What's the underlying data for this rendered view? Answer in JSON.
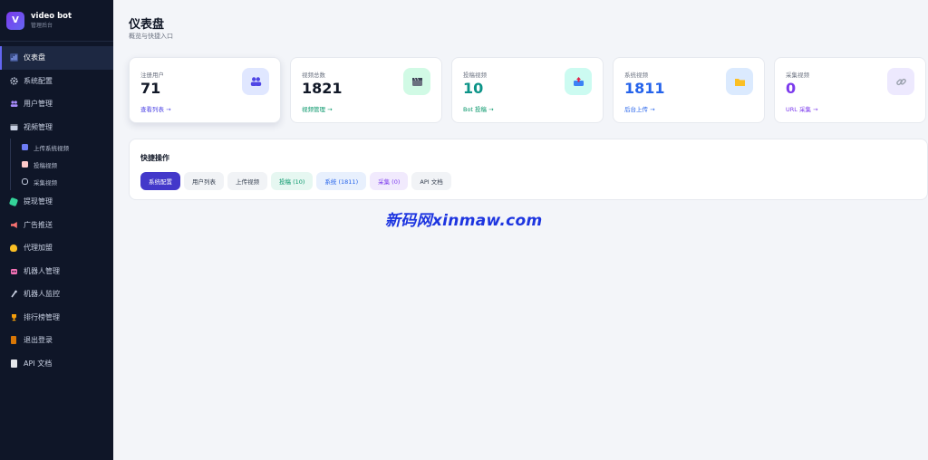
{
  "brand": {
    "logo_letter": "V",
    "title": "video bot",
    "subtitle": "管理后台"
  },
  "sidebar": {
    "items": [
      {
        "label": "仪表盘",
        "icon": "chart-icon",
        "color": "#8ea7ff",
        "active": true
      },
      {
        "label": "系统配置",
        "icon": "gear-icon",
        "color": "#c9d1e3"
      },
      {
        "label": "用户管理",
        "icon": "users-icon",
        "color": "#a78bfa"
      },
      {
        "label": "视频管理",
        "icon": "film-icon",
        "color": "#c9d1e3"
      }
    ],
    "sub_items": [
      {
        "label": "上传系统视频",
        "color": "#93a4ff"
      },
      {
        "label": "投稿视频",
        "color": "#fca5a5"
      },
      {
        "label": "采集视频",
        "color": "#c9d1e3"
      }
    ],
    "items_after": [
      {
        "label": "提现管理",
        "icon": "money-icon",
        "color": "#34d399"
      },
      {
        "label": "广告推送",
        "icon": "megaphone-icon",
        "color": "#f87171"
      },
      {
        "label": "代理加盟",
        "icon": "handshake-icon",
        "color": "#fbbf24"
      },
      {
        "label": "机器人管理",
        "icon": "robot-icon",
        "color": "#f472b6"
      },
      {
        "label": "机器人监控",
        "icon": "monitor-icon",
        "color": "#c9d1e3"
      },
      {
        "label": "排行榜管理",
        "icon": "trophy-icon",
        "color": "#f59e0b"
      },
      {
        "label": "退出登录",
        "icon": "door-icon",
        "color": "#d97706"
      },
      {
        "label": "API 文档",
        "icon": "document-icon",
        "color": "#e5e7eb"
      }
    ]
  },
  "header": {
    "title": "仪表盘",
    "subtitle": "概览与快捷入口"
  },
  "stats": [
    {
      "label": "注册用户",
      "value": "71",
      "link": "查看列表 →",
      "value_color": "#111827",
      "link_color": "#4f46e5",
      "icon": "users-icon",
      "icon_bg": "#e0e7ff",
      "icon_color": "#4f46e5"
    },
    {
      "label": "视频总数",
      "value": "1821",
      "link": "视频管理 →",
      "value_color": "#111827",
      "link_color": "#059669",
      "icon": "film-icon",
      "icon_bg": "#d1fae5",
      "icon_color": "#6b7280"
    },
    {
      "label": "投稿视频",
      "value": "10",
      "link": "Bot 投稿 →",
      "value_color": "#0d9488",
      "link_color": "#059669",
      "icon": "inbox-icon",
      "icon_bg": "#ccfbf1",
      "icon_color": "#e11d48"
    },
    {
      "label": "系统视频",
      "value": "1811",
      "link": "后台上传 →",
      "value_color": "#2563eb",
      "link_color": "#2563eb",
      "icon": "folder-icon",
      "icon_bg": "#dbeafe",
      "icon_color": "#fbbf24"
    },
    {
      "label": "采集视频",
      "value": "0",
      "link": "URL 采集 →",
      "value_color": "#7c3aed",
      "link_color": "#7c3aed",
      "icon": "link-icon",
      "icon_bg": "#ede9fe",
      "icon_color": "#9ca3af"
    }
  ],
  "quick": {
    "title": "快捷操作",
    "chips": [
      {
        "label": "系统配置",
        "bg": "#4338ca",
        "color": "#ffffff"
      },
      {
        "label": "用户列表",
        "bg": "#f1f3f6",
        "color": "#374151"
      },
      {
        "label": "上传视频",
        "bg": "#f1f3f6",
        "color": "#374151"
      },
      {
        "label": "投稿 (10)",
        "bg": "#e6f7f1",
        "color": "#059669"
      },
      {
        "label": "系统 (1811)",
        "bg": "#e8f0fd",
        "color": "#2563eb"
      },
      {
        "label": "采集 (0)",
        "bg": "#f1eafd",
        "color": "#7c3aed"
      },
      {
        "label": "API 文档",
        "bg": "#f1f3f6",
        "color": "#374151"
      }
    ]
  },
  "watermark": "新码网xinmaw.com"
}
